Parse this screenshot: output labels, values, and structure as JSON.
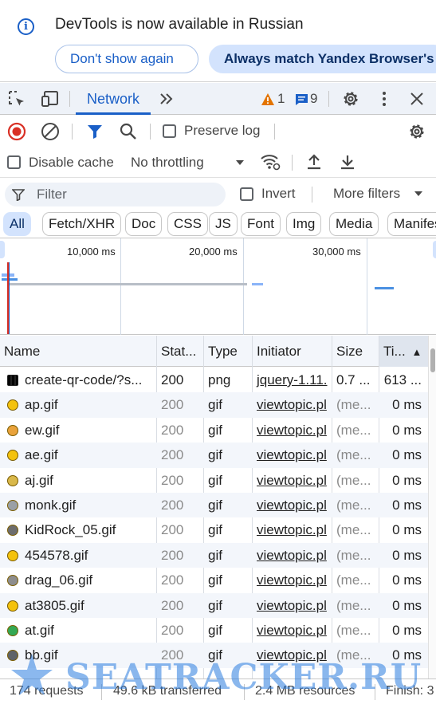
{
  "infobar": {
    "message": "DevTools is now available in Russian",
    "dont_show_label": "Don't show again",
    "always_match_label": "Always match Yandex Browser's l"
  },
  "tabbar": {
    "network_tab": "Network",
    "warnings_count": "1",
    "messages_count": "9",
    "accent_color": "#1a5fc7"
  },
  "toolbar": {
    "preserve_log": "Preserve log",
    "preserve_log_checked": false,
    "disable_cache": "Disable cache",
    "disable_cache_checked": false,
    "throttling": "No throttling"
  },
  "filter": {
    "placeholder": "Filter",
    "invert": "Invert",
    "invert_checked": false,
    "more_filters": "More filters"
  },
  "type_chips": [
    {
      "label": "All",
      "active": true
    },
    {
      "label": "Fetch/XHR",
      "active": false
    },
    {
      "label": "Doc",
      "active": false
    },
    {
      "label": "CSS",
      "active": false
    },
    {
      "label": "JS",
      "active": false
    },
    {
      "label": "Font",
      "active": false
    },
    {
      "label": "Img",
      "active": false
    },
    {
      "label": "Media",
      "active": false
    },
    {
      "label": "Manifes",
      "active": false
    }
  ],
  "overview": {
    "ticks": [
      "10,000 ms",
      "20,000 ms",
      "30,000 ms"
    ]
  },
  "table": {
    "columns": [
      "Name",
      "Stat...",
      "Type",
      "Initiator",
      "Size",
      "Ti..."
    ],
    "sort_indicator": "▲",
    "rows": [
      {
        "name": "create-qr-code/?s...",
        "status": "200",
        "type": "png",
        "initiator": "jquery-1.11.",
        "size": "0.7 ...",
        "time": "613 ...",
        "icon": "qr-icon"
      },
      {
        "name": "ap.gif",
        "status": "200",
        "type": "gif",
        "initiator": "viewtopic.pl",
        "size": "(me...",
        "time": "0 ms",
        "icon": "smiley-icon"
      },
      {
        "name": "ew.gif",
        "status": "200",
        "type": "gif",
        "initiator": "viewtopic.pl",
        "size": "(me...",
        "time": "0 ms",
        "icon": "smiley-icon"
      },
      {
        "name": "ae.gif",
        "status": "200",
        "type": "gif",
        "initiator": "viewtopic.pl",
        "size": "(me...",
        "time": "0 ms",
        "icon": "smiley-icon"
      },
      {
        "name": "aj.gif",
        "status": "200",
        "type": "gif",
        "initiator": "viewtopic.pl",
        "size": "(me...",
        "time": "0 ms",
        "icon": "smiley-icon"
      },
      {
        "name": "monk.gif",
        "status": "200",
        "type": "gif",
        "initiator": "viewtopic.pl",
        "size": "(me...",
        "time": "0 ms",
        "icon": "smiley-icon"
      },
      {
        "name": "KidRock_05.gif",
        "status": "200",
        "type": "gif",
        "initiator": "viewtopic.pl",
        "size": "(me...",
        "time": "0 ms",
        "icon": "smiley-icon"
      },
      {
        "name": "454578.gif",
        "status": "200",
        "type": "gif",
        "initiator": "viewtopic.pl",
        "size": "(me...",
        "time": "0 ms",
        "icon": "smiley-icon"
      },
      {
        "name": "drag_06.gif",
        "status": "200",
        "type": "gif",
        "initiator": "viewtopic.pl",
        "size": "(me...",
        "time": "0 ms",
        "icon": "smiley-icon"
      },
      {
        "name": "at3805.gif",
        "status": "200",
        "type": "gif",
        "initiator": "viewtopic.pl",
        "size": "(me...",
        "time": "0 ms",
        "icon": "smiley-icon"
      },
      {
        "name": "at.gif",
        "status": "200",
        "type": "gif",
        "initiator": "viewtopic.pl",
        "size": "(me...",
        "time": "0 ms",
        "icon": "smiley-icon"
      },
      {
        "name": "bb.gif",
        "status": "200",
        "type": "gif",
        "initiator": "viewtopic.pl",
        "size": "(me...",
        "time": "0 ms",
        "icon": "smiley-icon"
      }
    ]
  },
  "statusbar": {
    "requests": "174 requests",
    "transferred": "49.6 kB transferred",
    "resources": "2.4 MB resources",
    "finish": "Finish: 3"
  },
  "watermark": {
    "text": "SEATRACKER.RU"
  }
}
